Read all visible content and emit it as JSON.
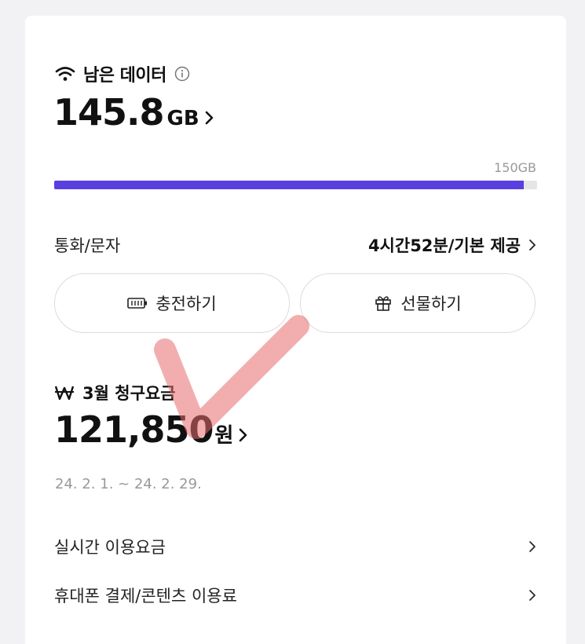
{
  "data": {
    "title": "남은 데이터",
    "remaining_value": "145.8",
    "remaining_unit": "GB",
    "total": "150GB",
    "usage_fraction": 0.972
  },
  "call": {
    "label": "통화/문자",
    "value": "4시간52분/기본 제공"
  },
  "buttons": {
    "charge": "충전하기",
    "gift": "선물하기"
  },
  "bill": {
    "title": "3월 청구요금",
    "amount": "121,850",
    "unit": "원",
    "period": "24. 2. 1. ~ 24. 2. 29."
  },
  "menu": [
    {
      "label": "실시간 이용요금"
    },
    {
      "label": "휴대폰 결제/콘텐츠 이용료"
    }
  ],
  "colors": {
    "accent": "#5a3fe0",
    "bar_track": "#e5e5e5",
    "annotation": "#e86b6b"
  }
}
